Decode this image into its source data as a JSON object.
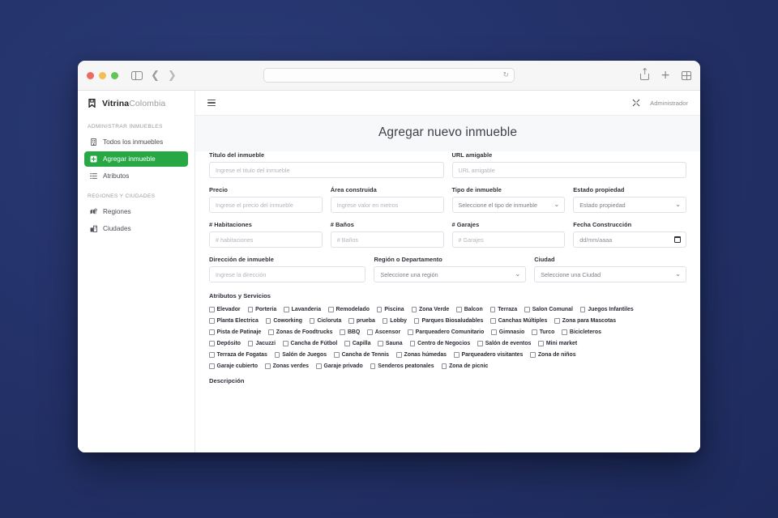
{
  "browser": {
    "address_value": "",
    "address_placeholder": "",
    "reload_icon": "reload-icon",
    "back_icon": "chevron-left-icon",
    "forward_icon": "chevron-right-icon",
    "sidebar_toggle_icon": "sidebar-toggle-icon",
    "share_icon": "share-icon",
    "new_tab_icon": "plus-icon",
    "tab_overview_icon": "tab-overview-icon"
  },
  "sidebar": {
    "brand": {
      "icon": "bookmark-icon",
      "name_strong": "Vitrina",
      "name_light": "Colombia"
    },
    "sections": [
      {
        "title": "ADMINISTRAR INMUEBLES",
        "items": [
          {
            "label": "Todos los inmuebles",
            "icon": "building-icon",
            "active": false
          },
          {
            "label": "Agregar inmueble",
            "icon": "plus-square-icon",
            "active": true
          },
          {
            "label": "Atributos",
            "icon": "list-icon",
            "active": false
          }
        ]
      },
      {
        "title": "REGIONES Y CIUDADES",
        "items": [
          {
            "label": "Regiones",
            "icon": "map-icon",
            "active": false
          },
          {
            "label": "Ciudades",
            "icon": "city-icon",
            "active": false
          }
        ]
      }
    ]
  },
  "topbar": {
    "menu_icon": "hamburger-icon",
    "expand_icon": "expand-icon",
    "user_label": "Administrador"
  },
  "page": {
    "title": "Agregar nuevo inmueble"
  },
  "form": {
    "row1": [
      {
        "label": "Titulo del inmueble",
        "placeholder": "Ingrese el titulo del inmueble",
        "type": "text"
      },
      {
        "label": "URL amigable",
        "placeholder": "URL amigable",
        "type": "text"
      }
    ],
    "row2": [
      {
        "label": "Precio",
        "placeholder": "Ingrese el precio del inmueble",
        "type": "text"
      },
      {
        "label": "Área construida",
        "placeholder": "Ingrese valor en metros",
        "type": "text"
      },
      {
        "label": "Tipo de inmueble",
        "placeholder": "Seleccione el tipo de inmueble",
        "type": "select"
      },
      {
        "label": "Estado propiedad",
        "placeholder": "Estado propiedad",
        "type": "select"
      }
    ],
    "row3": [
      {
        "label": "# Habitaciones",
        "placeholder": "# habitaciones",
        "type": "text"
      },
      {
        "label": "# Baños",
        "placeholder": "# Baños",
        "type": "text"
      },
      {
        "label": "# Garajes",
        "placeholder": "# Garajes",
        "type": "text"
      },
      {
        "label": "Fecha Construcción",
        "placeholder": "dd/mm/aaaa",
        "type": "date"
      }
    ],
    "row4": [
      {
        "label": "Dirección de inmueble",
        "placeholder": "Ingrese la dirección",
        "type": "text"
      },
      {
        "label": "Región o Departamento",
        "placeholder": "Seleccione una región",
        "type": "select"
      },
      {
        "label": "Ciudad",
        "placeholder": "Seleccione una Ciudad",
        "type": "select"
      }
    ]
  },
  "attributes": {
    "title": "Atributos y Servicios",
    "rows": [
      [
        "Elevador",
        "Porteria",
        "Lavanderia",
        "Remodelado",
        "Piscina",
        "Zona Verde",
        "Balcon",
        "Terraza",
        "Salon Comunal",
        "Juegos Infantiles"
      ],
      [
        "Planta Electrica",
        "Coworking",
        "Cicloruta",
        "prueba",
        "Lobby",
        "Parques Biosaludables",
        "Canchas Múltiples",
        "Zona para Mascotas"
      ],
      [
        "Pista de Patinaje",
        "Zonas de Foodtrucks",
        "BBQ",
        "Ascensor",
        "Parqueadero Comunitario",
        "Gimnasio",
        "Turco",
        "Bicicleteros"
      ],
      [
        "Depósito",
        "Jacuzzi",
        "Cancha de Fútbol",
        "Capilla",
        "Sauna",
        "Centro de Negocios",
        "Salón de eventos",
        "Mini market"
      ],
      [
        "Terraza de Fogatas",
        "Salón de Juegos",
        "Cancha de Tennis",
        "Zonas húmedas",
        "Parqueadero visitantes",
        "Zona de niños"
      ],
      [
        "Garaje cubierto",
        "Zonas verdes",
        "Garaje privado",
        "Senderos peatonales",
        "Zona de picnic"
      ]
    ]
  },
  "description": {
    "title": "Descripción"
  },
  "colors": {
    "accent_green": "#28a745",
    "desktop_bg": "#25356b",
    "content_bg": "#f7f8fa"
  }
}
